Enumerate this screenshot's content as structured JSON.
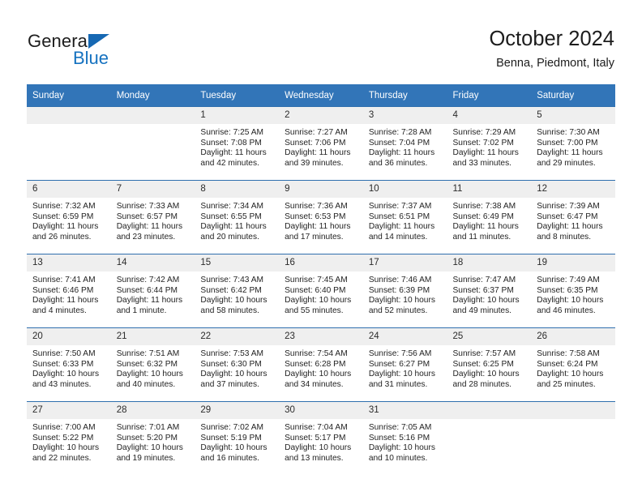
{
  "logo": {
    "word_top": "General",
    "word_bottom": "Blue",
    "triangle_color": "#1668b3",
    "blue_text_color": "#1572c0"
  },
  "header": {
    "title": "October 2024",
    "subtitle": "Benna, Piedmont, Italy"
  },
  "theme": {
    "header_blue": "#3275b8",
    "rule_blue": "#2f6fae",
    "daynum_band": "#efefef",
    "text": "#232323"
  },
  "weekdays": [
    "Sunday",
    "Monday",
    "Tuesday",
    "Wednesday",
    "Thursday",
    "Friday",
    "Saturday"
  ],
  "labels": {
    "sunrise_prefix": "Sunrise:",
    "sunset_prefix": "Sunset:",
    "daylight_prefix": "Daylight:"
  },
  "weeks": [
    [
      {
        "day": "",
        "lines": []
      },
      {
        "day": "",
        "lines": []
      },
      {
        "day": "1",
        "lines": [
          "Sunrise: 7:25 AM",
          "Sunset: 7:08 PM",
          "Daylight: 11 hours",
          "and 42 minutes."
        ]
      },
      {
        "day": "2",
        "lines": [
          "Sunrise: 7:27 AM",
          "Sunset: 7:06 PM",
          "Daylight: 11 hours",
          "and 39 minutes."
        ]
      },
      {
        "day": "3",
        "lines": [
          "Sunrise: 7:28 AM",
          "Sunset: 7:04 PM",
          "Daylight: 11 hours",
          "and 36 minutes."
        ]
      },
      {
        "day": "4",
        "lines": [
          "Sunrise: 7:29 AM",
          "Sunset: 7:02 PM",
          "Daylight: 11 hours",
          "and 33 minutes."
        ]
      },
      {
        "day": "5",
        "lines": [
          "Sunrise: 7:30 AM",
          "Sunset: 7:00 PM",
          "Daylight: 11 hours",
          "and 29 minutes."
        ]
      }
    ],
    [
      {
        "day": "6",
        "lines": [
          "Sunrise: 7:32 AM",
          "Sunset: 6:59 PM",
          "Daylight: 11 hours",
          "and 26 minutes."
        ]
      },
      {
        "day": "7",
        "lines": [
          "Sunrise: 7:33 AM",
          "Sunset: 6:57 PM",
          "Daylight: 11 hours",
          "and 23 minutes."
        ]
      },
      {
        "day": "8",
        "lines": [
          "Sunrise: 7:34 AM",
          "Sunset: 6:55 PM",
          "Daylight: 11 hours",
          "and 20 minutes."
        ]
      },
      {
        "day": "9",
        "lines": [
          "Sunrise: 7:36 AM",
          "Sunset: 6:53 PM",
          "Daylight: 11 hours",
          "and 17 minutes."
        ]
      },
      {
        "day": "10",
        "lines": [
          "Sunrise: 7:37 AM",
          "Sunset: 6:51 PM",
          "Daylight: 11 hours",
          "and 14 minutes."
        ]
      },
      {
        "day": "11",
        "lines": [
          "Sunrise: 7:38 AM",
          "Sunset: 6:49 PM",
          "Daylight: 11 hours",
          "and 11 minutes."
        ]
      },
      {
        "day": "12",
        "lines": [
          "Sunrise: 7:39 AM",
          "Sunset: 6:47 PM",
          "Daylight: 11 hours",
          "and 8 minutes."
        ]
      }
    ],
    [
      {
        "day": "13",
        "lines": [
          "Sunrise: 7:41 AM",
          "Sunset: 6:46 PM",
          "Daylight: 11 hours",
          "and 4 minutes."
        ]
      },
      {
        "day": "14",
        "lines": [
          "Sunrise: 7:42 AM",
          "Sunset: 6:44 PM",
          "Daylight: 11 hours",
          "and 1 minute."
        ]
      },
      {
        "day": "15",
        "lines": [
          "Sunrise: 7:43 AM",
          "Sunset: 6:42 PM",
          "Daylight: 10 hours",
          "and 58 minutes."
        ]
      },
      {
        "day": "16",
        "lines": [
          "Sunrise: 7:45 AM",
          "Sunset: 6:40 PM",
          "Daylight: 10 hours",
          "and 55 minutes."
        ]
      },
      {
        "day": "17",
        "lines": [
          "Sunrise: 7:46 AM",
          "Sunset: 6:39 PM",
          "Daylight: 10 hours",
          "and 52 minutes."
        ]
      },
      {
        "day": "18",
        "lines": [
          "Sunrise: 7:47 AM",
          "Sunset: 6:37 PM",
          "Daylight: 10 hours",
          "and 49 minutes."
        ]
      },
      {
        "day": "19",
        "lines": [
          "Sunrise: 7:49 AM",
          "Sunset: 6:35 PM",
          "Daylight: 10 hours",
          "and 46 minutes."
        ]
      }
    ],
    [
      {
        "day": "20",
        "lines": [
          "Sunrise: 7:50 AM",
          "Sunset: 6:33 PM",
          "Daylight: 10 hours",
          "and 43 minutes."
        ]
      },
      {
        "day": "21",
        "lines": [
          "Sunrise: 7:51 AM",
          "Sunset: 6:32 PM",
          "Daylight: 10 hours",
          "and 40 minutes."
        ]
      },
      {
        "day": "22",
        "lines": [
          "Sunrise: 7:53 AM",
          "Sunset: 6:30 PM",
          "Daylight: 10 hours",
          "and 37 minutes."
        ]
      },
      {
        "day": "23",
        "lines": [
          "Sunrise: 7:54 AM",
          "Sunset: 6:28 PM",
          "Daylight: 10 hours",
          "and 34 minutes."
        ]
      },
      {
        "day": "24",
        "lines": [
          "Sunrise: 7:56 AM",
          "Sunset: 6:27 PM",
          "Daylight: 10 hours",
          "and 31 minutes."
        ]
      },
      {
        "day": "25",
        "lines": [
          "Sunrise: 7:57 AM",
          "Sunset: 6:25 PM",
          "Daylight: 10 hours",
          "and 28 minutes."
        ]
      },
      {
        "day": "26",
        "lines": [
          "Sunrise: 7:58 AM",
          "Sunset: 6:24 PM",
          "Daylight: 10 hours",
          "and 25 minutes."
        ]
      }
    ],
    [
      {
        "day": "27",
        "lines": [
          "Sunrise: 7:00 AM",
          "Sunset: 5:22 PM",
          "Daylight: 10 hours",
          "and 22 minutes."
        ]
      },
      {
        "day": "28",
        "lines": [
          "Sunrise: 7:01 AM",
          "Sunset: 5:20 PM",
          "Daylight: 10 hours",
          "and 19 minutes."
        ]
      },
      {
        "day": "29",
        "lines": [
          "Sunrise: 7:02 AM",
          "Sunset: 5:19 PM",
          "Daylight: 10 hours",
          "and 16 minutes."
        ]
      },
      {
        "day": "30",
        "lines": [
          "Sunrise: 7:04 AM",
          "Sunset: 5:17 PM",
          "Daylight: 10 hours",
          "and 13 minutes."
        ]
      },
      {
        "day": "31",
        "lines": [
          "Sunrise: 7:05 AM",
          "Sunset: 5:16 PM",
          "Daylight: 10 hours",
          "and 10 minutes."
        ]
      },
      {
        "day": "",
        "lines": []
      },
      {
        "day": "",
        "lines": []
      }
    ]
  ]
}
